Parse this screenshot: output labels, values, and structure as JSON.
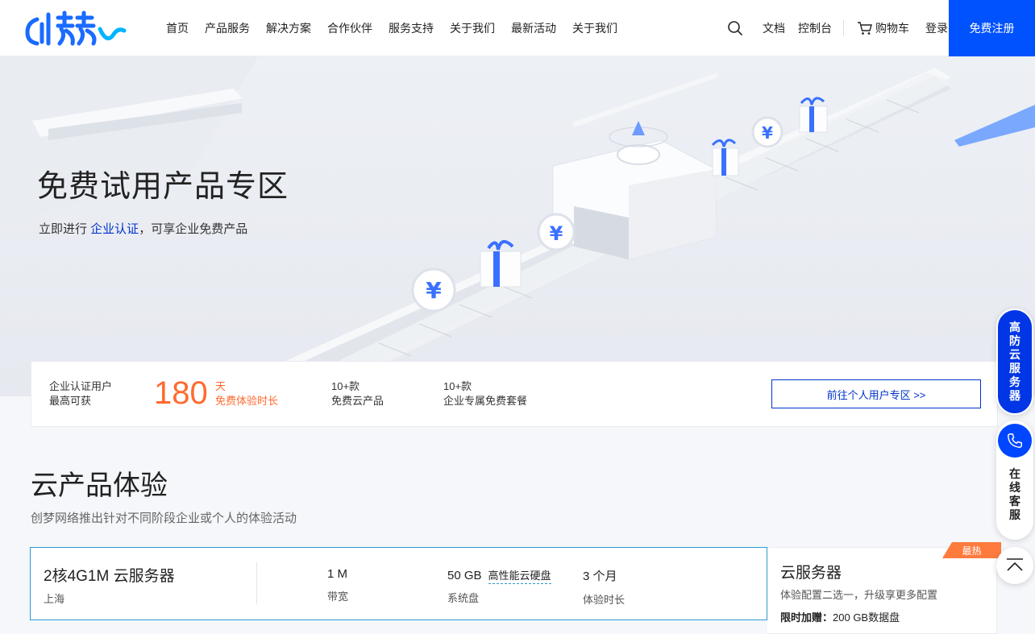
{
  "brand": {
    "logo_text": "创梦",
    "accent": "#0052ff",
    "orange": "#ff6a2f"
  },
  "nav": [
    "首页",
    "产品服务",
    "解决方案",
    "合作伙伴",
    "服务支持",
    "关于我们",
    "最新活动",
    "关于我们"
  ],
  "header_tools": {
    "search_icon": "search-icon",
    "docs": "文档",
    "console": "控制台",
    "cart": "购物车",
    "login": "登录",
    "register": "免费注册"
  },
  "hero": {
    "title": "免费试用产品专区",
    "sub_prefix": "立即进行 ",
    "sub_link": "企业认证",
    "sub_suffix": "，可享企业免费产品"
  },
  "stats": {
    "label_line1": "企业认证用户",
    "label_line2": "最高可获",
    "days": "180",
    "days_unit": "天",
    "days_desc": "免费体验时长",
    "s2_num": "10+款",
    "s2_desc": "免费云产品",
    "s3_num": "10+款",
    "s3_desc": "企业专属免费套餐",
    "personal_btn": "前往个人用户专区 >>"
  },
  "section": {
    "title": "云产品体验",
    "subtitle": "创梦网络推出针对不同阶段企业或个人的体验活动"
  },
  "product": {
    "name": "2核4G1M 云服务器",
    "region": "上海",
    "bandwidth_value": "1 M",
    "bandwidth_label": "带宽",
    "disk_value": "50 GB",
    "disk_type": "高性能云硬盘",
    "disk_label": "系统盘",
    "duration_value": "3 个月",
    "duration_label": "体验时长"
  },
  "side_panel": {
    "hot_badge": "最热",
    "title": "云服务器",
    "subtitle": "体验配置二选一，升级享更多配置",
    "promo_label": "限时加赠：",
    "promo_value": "200 GB数据盘"
  },
  "float": {
    "anti_ddos": [
      "高",
      "防",
      "云",
      "服",
      "务",
      "器"
    ],
    "online_service": [
      "在",
      "线",
      "客",
      "服"
    ]
  }
}
